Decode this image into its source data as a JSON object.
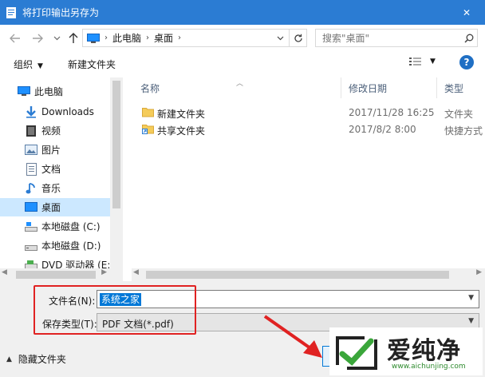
{
  "window": {
    "title": "将打印输出另存为",
    "close_glyph": "✕"
  },
  "address": {
    "crumbs": [
      "此电脑",
      "桌面"
    ],
    "search_placeholder": "搜索\"桌面\""
  },
  "toolbar": {
    "organize_label": "组织",
    "new_folder_label": "新建文件夹",
    "help_label": "?"
  },
  "nav": {
    "items": [
      {
        "label": "此电脑",
        "icon": "computer-icon"
      },
      {
        "label": "Downloads",
        "icon": "downloads-icon"
      },
      {
        "label": "视频",
        "icon": "videos-icon"
      },
      {
        "label": "图片",
        "icon": "pictures-icon"
      },
      {
        "label": "文档",
        "icon": "documents-icon"
      },
      {
        "label": "音乐",
        "icon": "music-icon"
      },
      {
        "label": "桌面",
        "icon": "desktop-icon"
      },
      {
        "label": "本地磁盘 (C:)",
        "icon": "drive-c-icon"
      },
      {
        "label": "本地磁盘 (D:)",
        "icon": "drive-d-icon"
      },
      {
        "label": "DVD 驱动器 (E:)",
        "icon": "dvd-drive-icon"
      }
    ],
    "selected_index": 6
  },
  "files": {
    "columns": [
      "名称",
      "修改日期",
      "类型"
    ],
    "rows": [
      {
        "name": "新建文件夹",
        "date": "2017/11/28 16:25",
        "type": "文件夹",
        "icon": "folder-icon"
      },
      {
        "name": "共享文件夹",
        "date": "2017/8/2 8:00",
        "type": "快捷方式",
        "icon": "folder-shortcut-icon"
      }
    ]
  },
  "save": {
    "filename_label": "文件名(N):",
    "filename_value": "系统之家",
    "filetype_label": "保存类型(T):",
    "filetype_value": "PDF 文档(*.pdf)",
    "hide_folders_label": "隐藏文件夹"
  },
  "watermark": {
    "text": "爱纯净",
    "url": "www.aichunjing.com"
  },
  "colors": {
    "titlebar": "#2b7cd3",
    "selection": "#cce8ff",
    "highlight": "#0078d7",
    "annotation_red": "#e02222"
  }
}
